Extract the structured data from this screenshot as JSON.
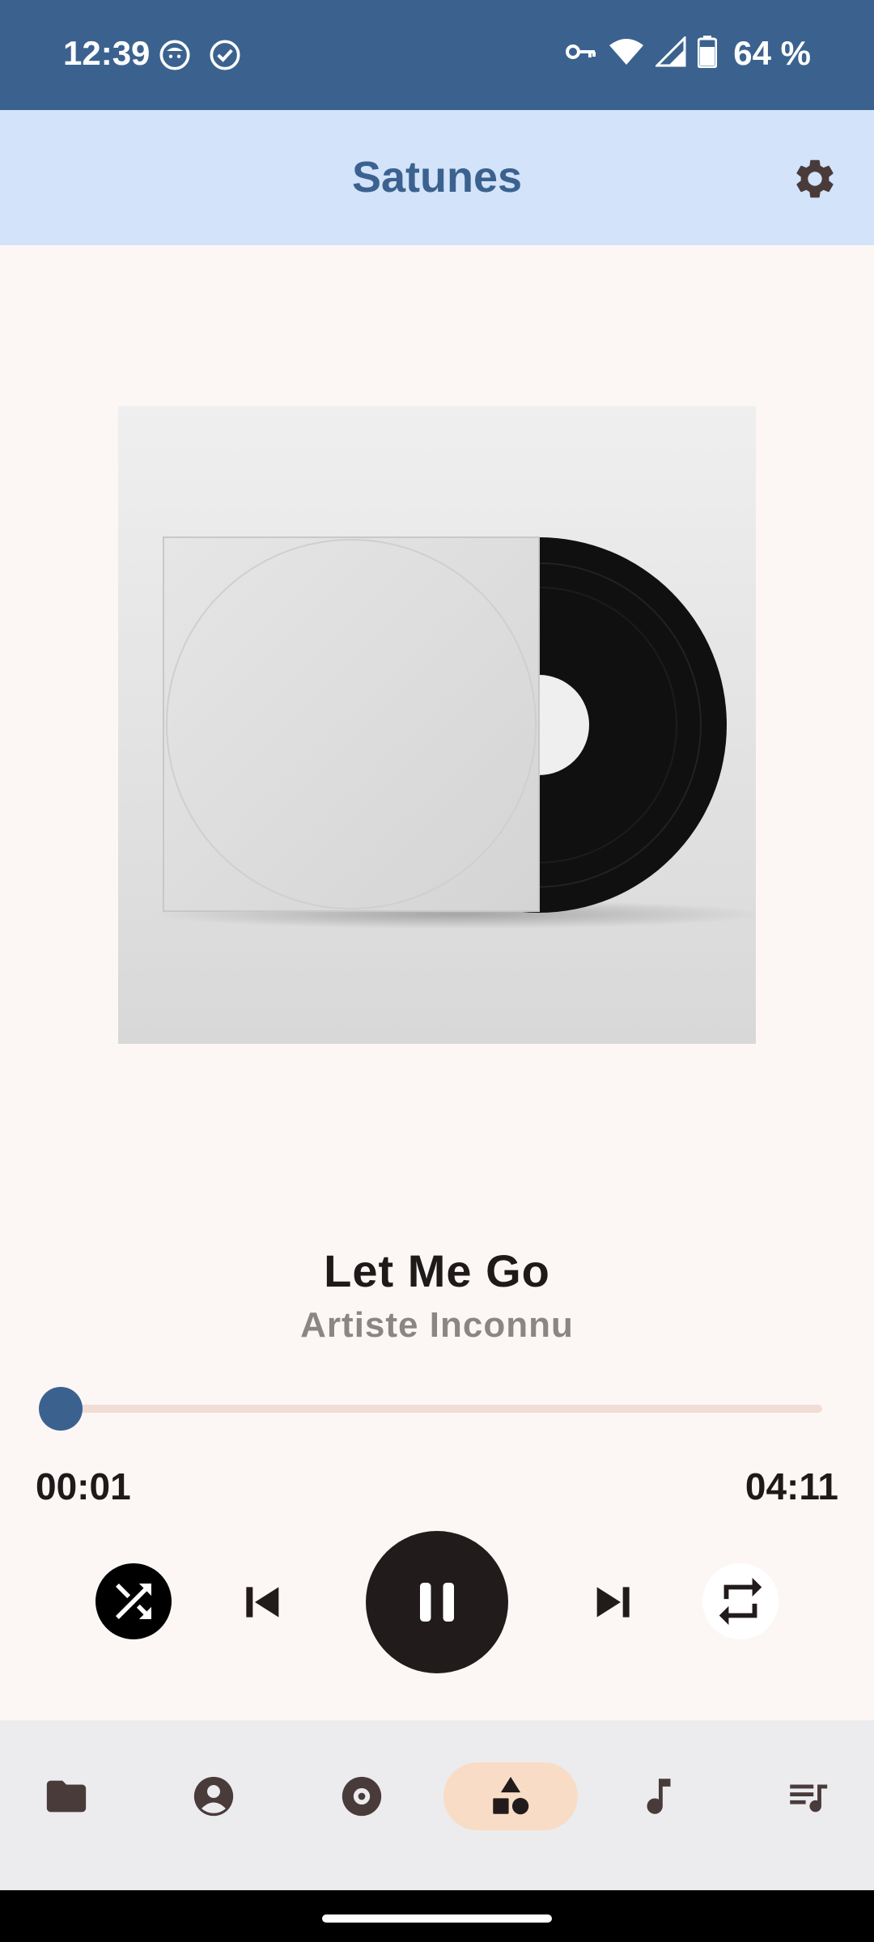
{
  "status_bar": {
    "time": "12:39",
    "battery": "64 %",
    "icons": [
      "face-notification-icon",
      "check-circle-icon",
      "vpn-key-icon",
      "wifi-icon",
      "signal-icon",
      "battery-icon"
    ],
    "background": "#3b628f"
  },
  "app_bar": {
    "title": "Satunes",
    "settings_icon": "gear-icon",
    "background": "#d3e3fa",
    "title_color": "#3b628f"
  },
  "player": {
    "artwork_icon": "vinyl-record-artwork",
    "title": "Let Me Go",
    "artist": "Artiste Inconnu",
    "elapsed": "00:01",
    "total": "04:11",
    "progress": 0.004,
    "accent": "#3b628f",
    "controls": [
      "shuffle-icon",
      "skip-previous-icon",
      "pause-icon",
      "skip-next-icon",
      "repeat-icon"
    ]
  },
  "bottom_nav": {
    "items": [
      {
        "icon": "folder-icon",
        "selected": false
      },
      {
        "icon": "person-icon",
        "selected": false
      },
      {
        "icon": "album-icon",
        "selected": false
      },
      {
        "icon": "genres-shapes-icon",
        "selected": true
      },
      {
        "icon": "music-note-icon",
        "selected": false
      },
      {
        "icon": "playlist-icon",
        "selected": false
      }
    ],
    "selected_color": "#f8dcc6"
  }
}
